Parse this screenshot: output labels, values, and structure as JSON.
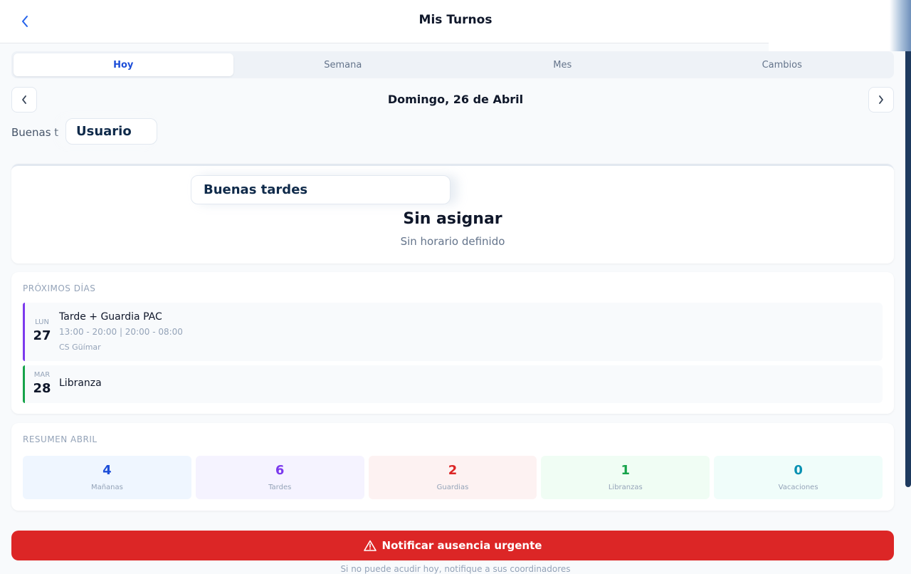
{
  "header": {
    "title": "Mis Turnos",
    "back_icon": "chevron-left-icon"
  },
  "tabs": [
    {
      "label": "Hoy",
      "active": true
    },
    {
      "label": "Semana",
      "active": false
    },
    {
      "label": "Mes",
      "active": false
    },
    {
      "label": "Cambios",
      "active": false
    }
  ],
  "date_nav": {
    "label": "Domingo, 26 de Abril",
    "prev_icon": "chevron-left-icon",
    "next_icon": "chevron-right-icon"
  },
  "greeting": {
    "prefix": "Buenas t",
    "user_chip": "Usuario"
  },
  "today": {
    "greeting_chip": "Buenas tardes",
    "shift_name": "Sin asignar",
    "shift_hours": "Sin horario definido"
  },
  "upcoming": {
    "title": "PRÓXIMOS DÍAS",
    "days": [
      {
        "dow": "LUN",
        "day": "27",
        "title": "Tarde + Guardia PAC",
        "hours": "13:00 - 20:00 | 20:00 - 08:00",
        "location": "CS Güímar",
        "accent": "#7c3aed"
      },
      {
        "dow": "MAR",
        "day": "28",
        "title": "Libranza",
        "accent": "#16a34a"
      }
    ]
  },
  "summary": {
    "title": "RESUMEN ABRIL",
    "stats": [
      {
        "value": "4",
        "label": "Mañanas",
        "color": "#1d4ed8",
        "bg": "#eff6ff"
      },
      {
        "value": "6",
        "label": "Tardes",
        "color": "#7c3aed",
        "bg": "#f5f3ff"
      },
      {
        "value": "2",
        "label": "Guardias",
        "color": "#dc2626",
        "bg": "#fdf2f2"
      },
      {
        "value": "1",
        "label": "Libranzas",
        "color": "#16a34a",
        "bg": "#f0fdf4"
      },
      {
        "value": "0",
        "label": "Vacaciones",
        "color": "#0891b2",
        "bg": "#f0fdfa"
      }
    ]
  },
  "urgent": {
    "label": "Notificar ausencia urgente",
    "icon": "warning-icon",
    "hint": "Si no puede acudir hoy, notifique a sus coordinadores"
  }
}
